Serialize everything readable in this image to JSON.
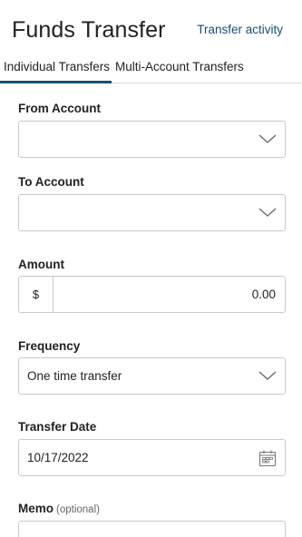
{
  "header": {
    "title": "Funds Transfer",
    "activity_link": "Transfer activity"
  },
  "tabs": [
    {
      "label": "Individual Transfers",
      "active": true
    },
    {
      "label": "Multi-Account Transfers",
      "active": false
    }
  ],
  "form": {
    "from_account": {
      "label": "From Account",
      "value": ""
    },
    "to_account": {
      "label": "To Account",
      "value": ""
    },
    "amount": {
      "label": "Amount",
      "prefix": "$",
      "value": "0.00"
    },
    "frequency": {
      "label": "Frequency",
      "value": "One time transfer"
    },
    "transfer_date": {
      "label": "Transfer Date",
      "value": "10/17/2022"
    },
    "memo": {
      "label": "Memo",
      "hint": "(optional)",
      "value": ""
    }
  },
  "colors": {
    "accent": "#1d4f6f",
    "border": "#c9c9c9",
    "text": "#222222"
  },
  "icons": {
    "dropdown": "chevron-down-icon",
    "date": "calendar-icon"
  }
}
